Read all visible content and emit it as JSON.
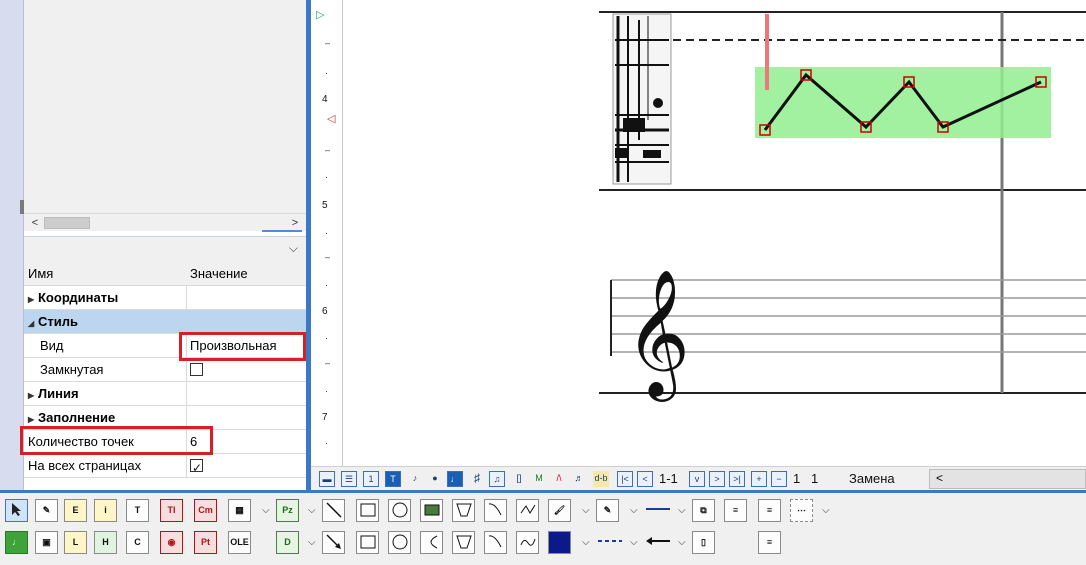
{
  "panel": {
    "columns": {
      "name": "Имя",
      "value": "Значение"
    },
    "rows": [
      {
        "name": "Координаты",
        "value": ""
      },
      {
        "name": "Стиль",
        "value": ""
      },
      {
        "name": "Вид",
        "value": "Произвольная"
      },
      {
        "name": "Замкнутая",
        "value": ""
      },
      {
        "name": "Линия",
        "value": ""
      },
      {
        "name": "Заполнение",
        "value": ""
      },
      {
        "name": "Количество точек",
        "value": "6"
      },
      {
        "name": "На всех страницах",
        "value": ""
      }
    ],
    "zamknutaya_checked": false,
    "all_pages_checked": true
  },
  "ruler": {
    "labels": [
      "4",
      "5",
      "6",
      "7"
    ]
  },
  "status": {
    "page_range": "1-1",
    "num1": "1",
    "num2": "1",
    "mode": "Замена"
  },
  "toolbar": {
    "row1_labels": [
      "E",
      "i",
      "T",
      "TI",
      "Cm",
      "Pz"
    ],
    "row2_labels": [
      "L",
      "C",
      "Pt",
      "OLE",
      "D"
    ],
    "highlight_color": "#90ee90",
    "accent_color": "#3b78c8",
    "red_marker": "#d61f26"
  }
}
